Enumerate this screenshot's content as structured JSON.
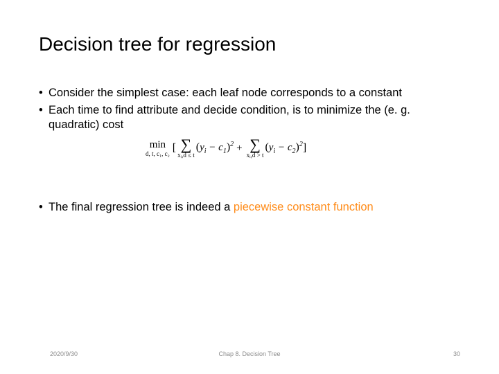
{
  "title": "Decision tree  for  regression",
  "bullets": {
    "b1": "Consider the simplest case: each leaf node corresponds to a constant",
    "b2": "Each time to find attribute and decide condition, is to minimize the (e. g. quadratic) cost",
    "b3_prefix": "The final regression tree is indeed a ",
    "b3_highlight": "piecewise constant function"
  },
  "formula": {
    "min_label": "min",
    "min_sub": "d, t, c₁, c₂",
    "lbracket": "[",
    "rbracket": "]",
    "sum1_sub": "xᵢ,d ≤ t",
    "sum2_sub": "xᵢ,d > t",
    "term1_lparen": "(",
    "term1_y": "y",
    "term1_ysub": "i",
    "term1_minus": " − ",
    "term1_c": "c",
    "term1_csub": "1",
    "term1_rparen": ")",
    "term1_sq": "2",
    "plus": "+",
    "term2_lparen": "(",
    "term2_y": "y",
    "term2_ysub": "i",
    "term2_minus": " − ",
    "term2_c": "c",
    "term2_csub": "2",
    "term2_rparen": ")",
    "term2_sq": "2",
    "sigma": "∑"
  },
  "footer": {
    "date": "2020/9/30",
    "chapter": "Chap 8. Decision Tree",
    "page": "30"
  }
}
